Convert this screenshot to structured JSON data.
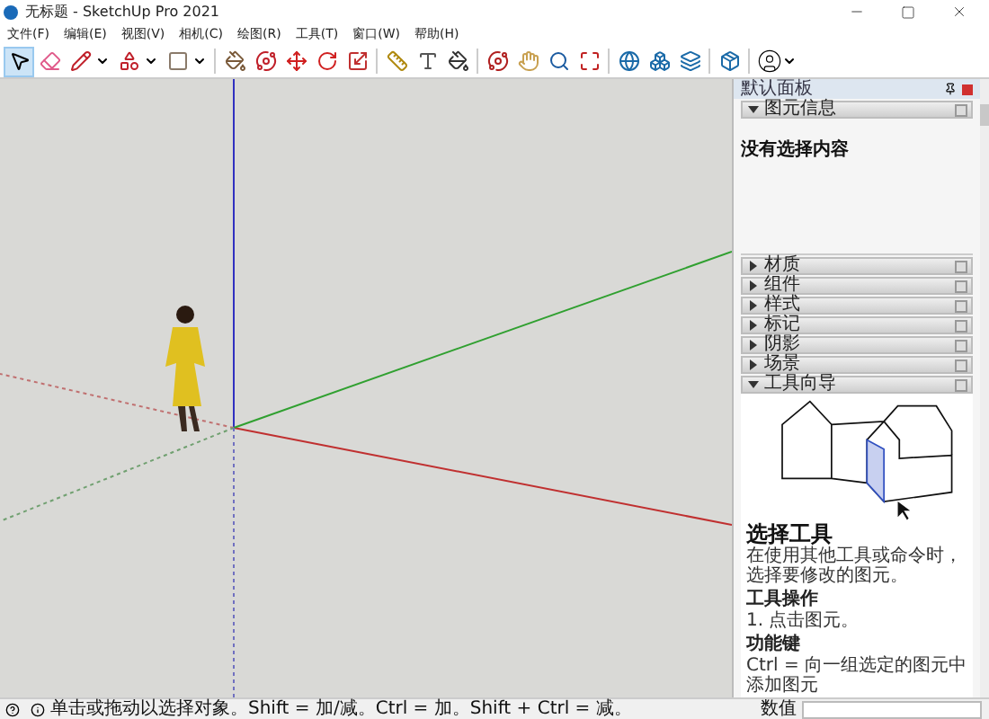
{
  "window": {
    "title": "无标题 - SketchUp Pro 2021"
  },
  "menu": [
    "文件(F)",
    "编辑(E)",
    "视图(V)",
    "相机(C)",
    "绘图(R)",
    "工具(T)",
    "窗口(W)",
    "帮助(H)"
  ],
  "toolbar_tools": [
    {
      "selected": true
    },
    {
      "selected": false
    },
    {
      "selected": false
    },
    {
      "selected": false
    },
    {
      "selected": false
    },
    {
      "selected": false
    },
    {
      "selected": false
    },
    {
      "selected": false
    },
    {
      "selected": false
    },
    {
      "selected": false
    },
    {
      "selected": false
    },
    {
      "selected": false
    },
    {
      "selected": false
    },
    {
      "selected": false
    },
    {
      "selected": false
    },
    {
      "selected": false
    },
    {
      "selected": false
    },
    {
      "selected": false
    },
    {
      "selected": false
    },
    {
      "selected": false
    },
    {
      "selected": false
    }
  ],
  "panel": {
    "title": "默认面板",
    "trays": [
      {
        "label": "图元信息",
        "expanded": true
      },
      {
        "label": "材质",
        "expanded": false
      },
      {
        "label": "组件",
        "expanded": false
      },
      {
        "label": "样式",
        "expanded": false
      },
      {
        "label": "标记",
        "expanded": false
      },
      {
        "label": "阴影",
        "expanded": false
      },
      {
        "label": "场景",
        "expanded": false
      },
      {
        "label": "工具向导",
        "expanded": true
      }
    ],
    "entity_info": "没有选择内容",
    "instructor": {
      "title": "选择工具",
      "description": "在使用其他工具或命令时，选择要修改的图元。",
      "sections": [
        {
          "heading": "工具操作",
          "text": "1. 点击图元。"
        },
        {
          "heading": "功能键",
          "text": "Ctrl = 向一组选定的图元中添加图元"
        }
      ]
    }
  },
  "status_bar": {
    "message": "单击或拖动以选择对象。Shift = 加/减。Ctrl = 加。Shift + Ctrl = 减。",
    "measurements_label": "数值"
  }
}
